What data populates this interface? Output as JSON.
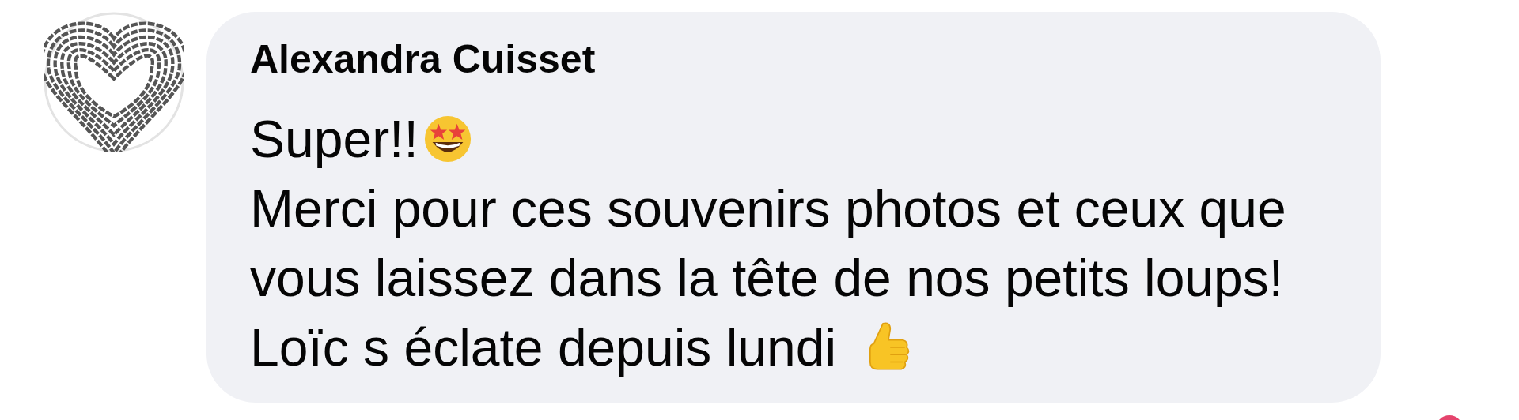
{
  "comment": {
    "author": "Alexandra Cuisset",
    "lines": [
      {
        "text": "Super!!",
        "kind": "star_face"
      },
      {
        "text": "Merci pour ces souvenirs photos et ceux que",
        "kind": "plain"
      },
      {
        "text": "vous laissez dans la tête de nos petits loups!",
        "kind": "plain"
      },
      {
        "text": "Loïc s éclate depuis lundi",
        "kind": "thumb"
      }
    ]
  }
}
